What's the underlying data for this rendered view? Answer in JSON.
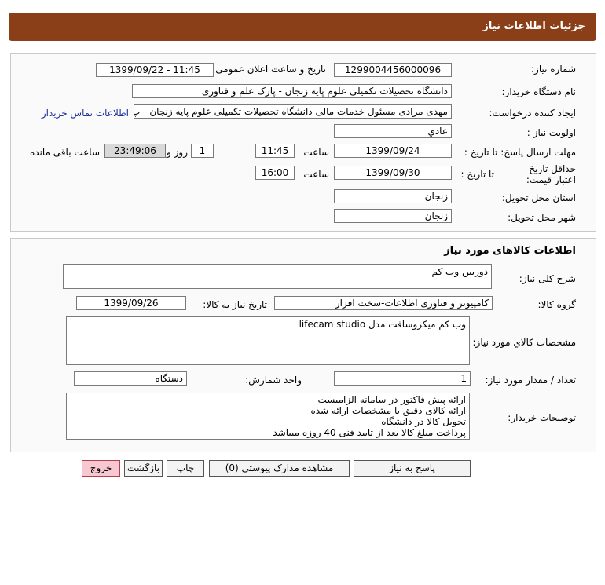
{
  "header": {
    "title": "جزئیات اطلاعات نیاز"
  },
  "info": {
    "need_number_label": "شماره نیاز:",
    "need_number": "1299004456000096",
    "announce_label": "تاریخ و ساعت اعلان عمومی:",
    "announce_value": "1399/09/22 - 11:45",
    "buyer_org_label": "نام دستگاه خریدار:",
    "buyer_org": "دانشگاه تحصیلات تکمیلی علوم پایه زنجان - پارک علم و فناوری",
    "requester_label": "ایجاد کننده درخواست:",
    "requester": "مهدی مرادی مسئول خدمات مالی دانشگاه تحصیلات تکمیلی علوم پایه زنجان - پ",
    "contact_link": "اطلاعات تماس خریدار",
    "priority_label": "اولویت نیاز :",
    "priority": "عادي",
    "deadline_label": "مهلت ارسال پاسخ: تا تاریخ :",
    "deadline_date": "1399/09/24",
    "time_label": "ساعت",
    "deadline_time": "11:45",
    "days_value": "1",
    "days_label": "روز و",
    "remaining_time": "23:49:06",
    "remaining_label": "ساعت باقی مانده",
    "validity_label": "حداقل تاریخ اعتبار قیمت:",
    "validity_to_label": "تا تاریخ :",
    "validity_date": "1399/09/30",
    "validity_time_label": "ساعت",
    "validity_time": "16:00",
    "province_label": "استان محل تحویل:",
    "province": "زنجان",
    "city_label": "شهر محل تحویل:",
    "city": "زنجان"
  },
  "goods": {
    "section_title": "اطلاعات کالاهای مورد نیاز",
    "summary_label": "شرح کلی نیاز:",
    "summary": "دوربین وب کم",
    "group_label": "گروه کالا:",
    "group": "کامپیوتر و فناوری اطلاعات-سخت افزار",
    "need_date_label": "تاریخ نیاز به کالا:",
    "need_date": "1399/09/26",
    "specs_label": "مشخصات کالاي مورد نیاز:",
    "specs": "وب کم میکروسافت مدل lifecam studio",
    "qty_label": "تعداد / مقدار مورد نیاز:",
    "qty": "1",
    "unit_label": "واحد شمارش:",
    "unit": "دستگاه",
    "notes_label": "توضیحات خریدار:",
    "notes": [
      "ارائه پیش فاکتور در سامانه الزامیست",
      "ارائه کالای دقیق با مشخصات ارائه شده",
      "تحویل کالا در دانشگاه",
      "پرداخت مبلغ کالا بعد از تایید فنی 40 روزه میباشد"
    ]
  },
  "buttons": {
    "reply": "پاسخ به نیاز",
    "attachments": "مشاهده مدارک پیوستی (0)",
    "print": "چاپ",
    "back": "بازگشت",
    "exit": "خروج"
  }
}
